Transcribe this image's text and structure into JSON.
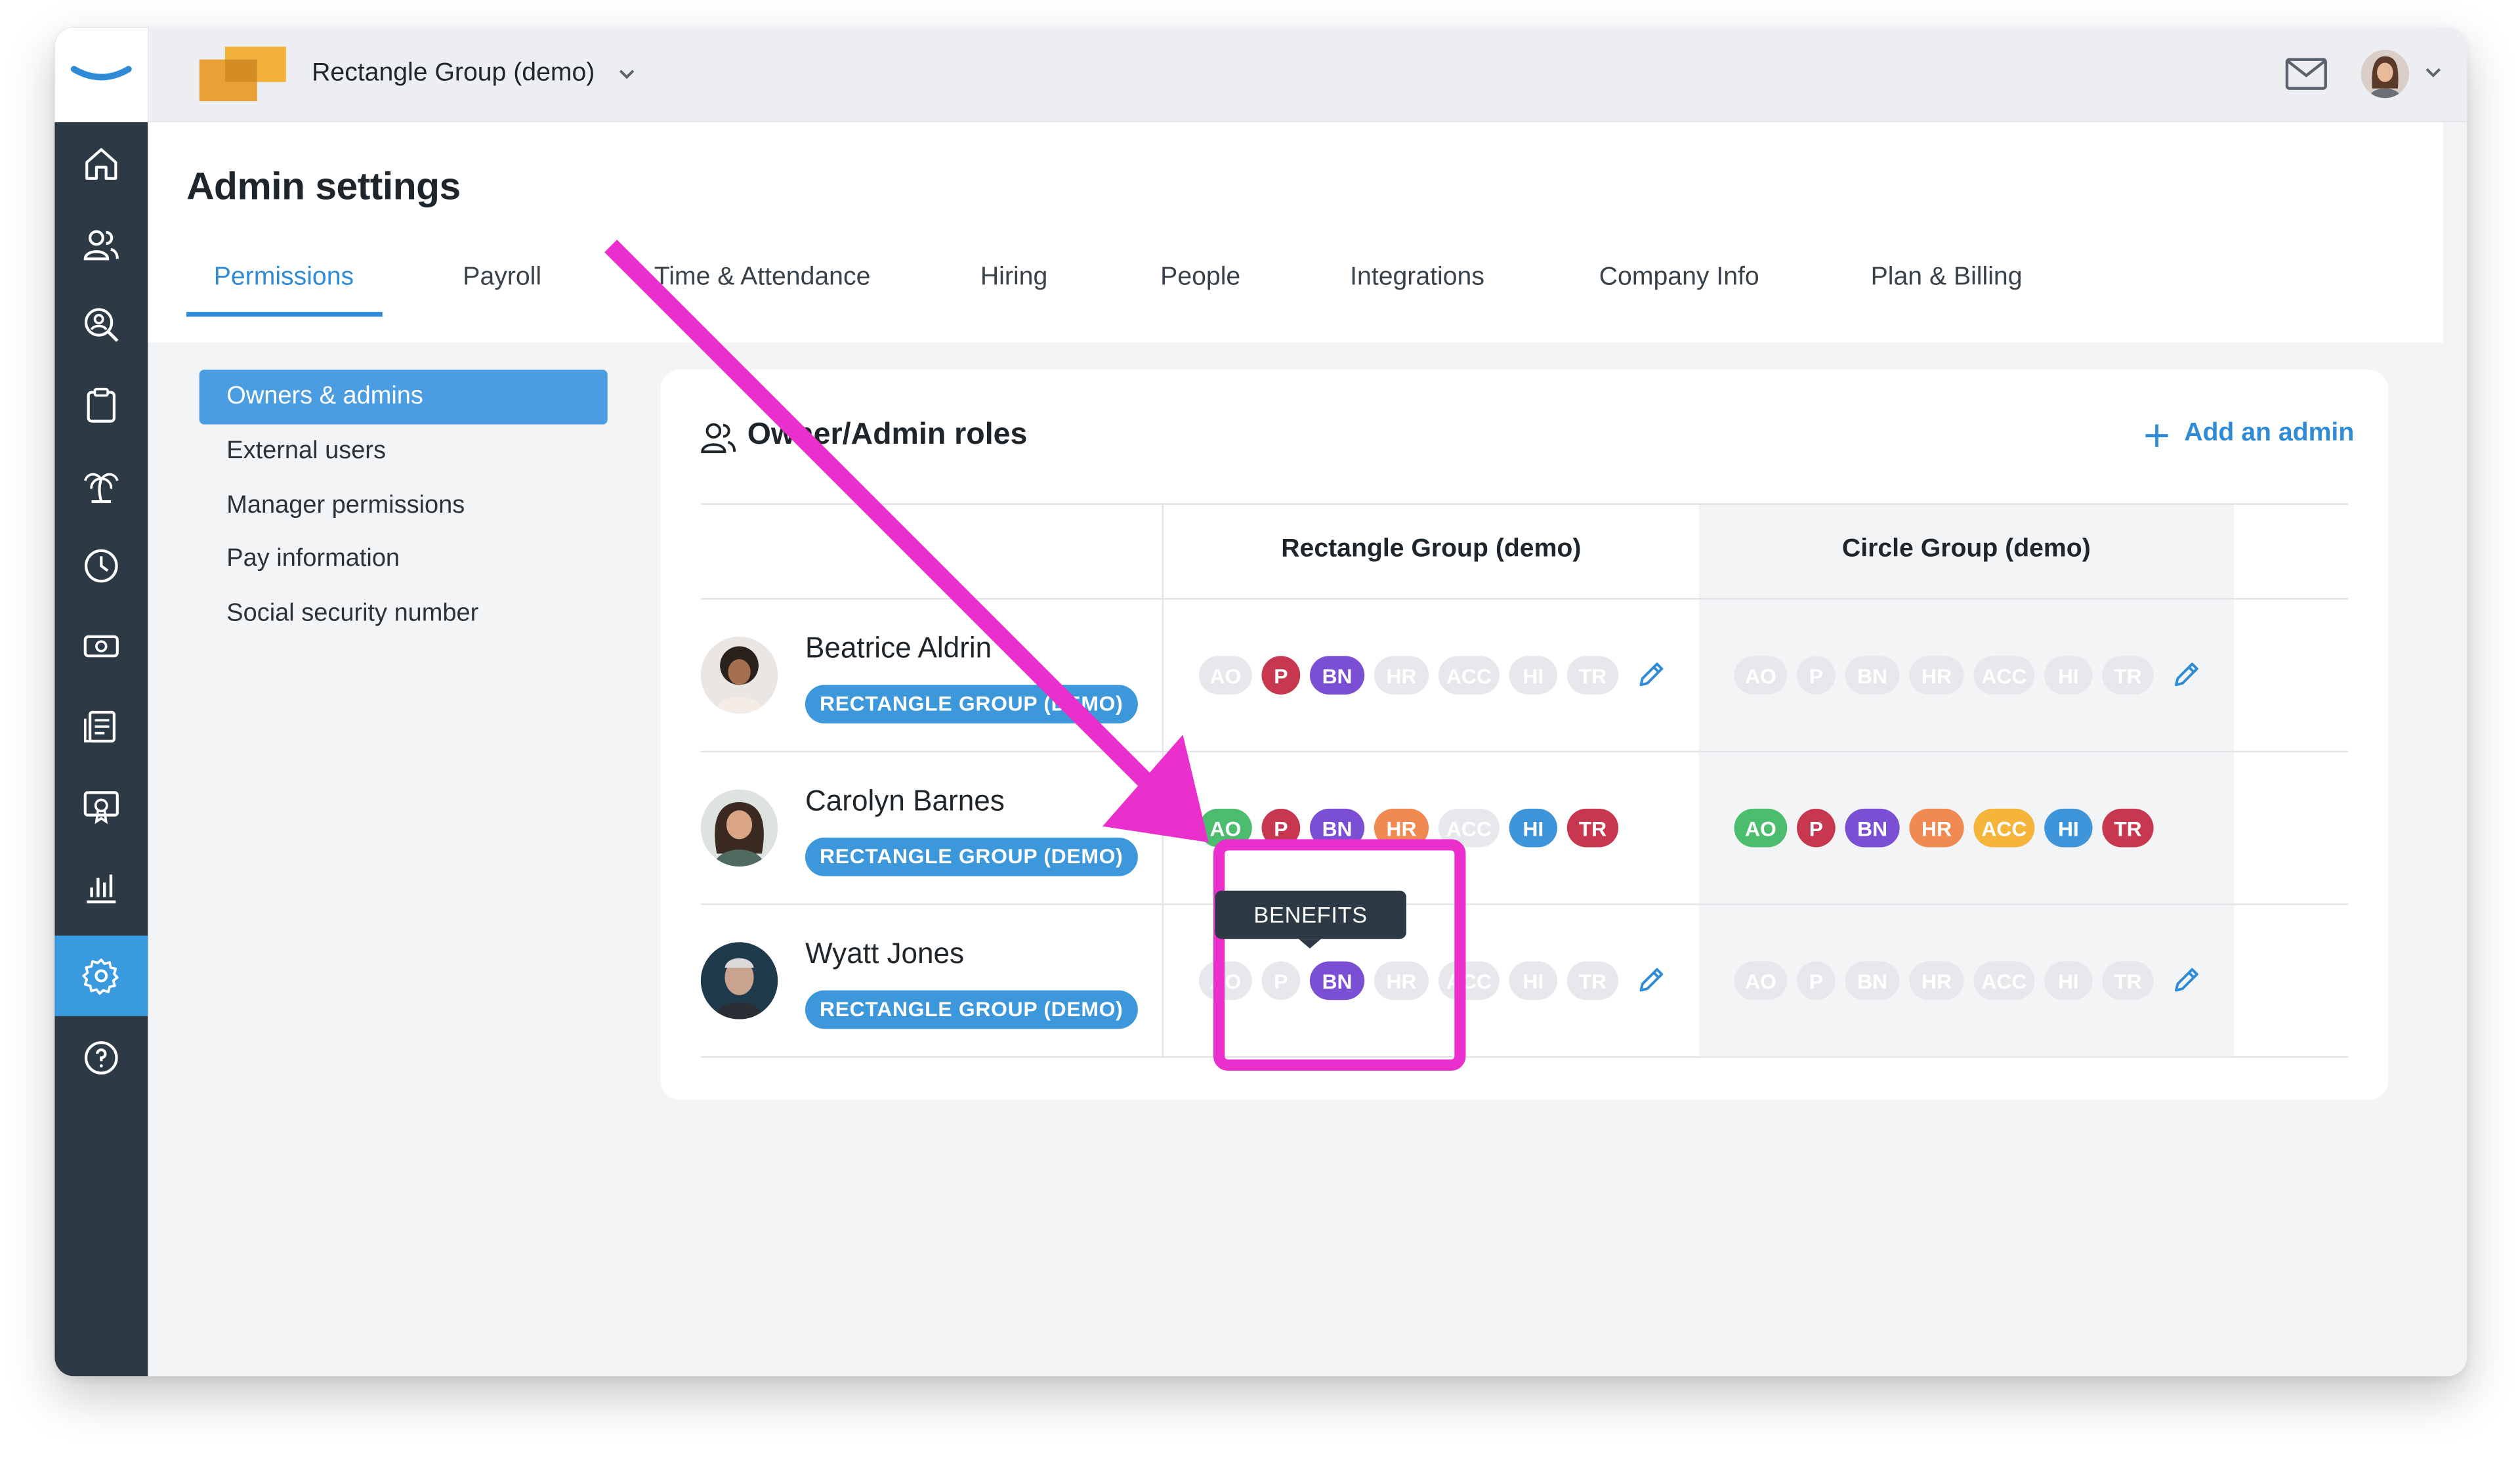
{
  "topbar": {
    "company_name": "Rectangle Group (demo)",
    "icons": [
      "brand-logo",
      "chevron-down-icon",
      "mail-icon",
      "avatar",
      "chevron-down-icon"
    ]
  },
  "rail": {
    "icons": [
      "home-icon",
      "people-icon",
      "search-person-icon",
      "clipboard-icon",
      "palm-tree-icon",
      "clock-icon",
      "money-icon",
      "document-icon",
      "certificate-icon",
      "bar-chart-icon",
      "gear-icon",
      "help-icon"
    ],
    "active": "gear-icon"
  },
  "page": {
    "title": "Admin settings",
    "tabs": [
      {
        "label": "Permissions",
        "active": true
      },
      {
        "label": "Payroll"
      },
      {
        "label": "Time & Attendance"
      },
      {
        "label": "Hiring"
      },
      {
        "label": "People"
      },
      {
        "label": "Integrations"
      },
      {
        "label": "Company Info"
      },
      {
        "label": "Plan & Billing"
      }
    ]
  },
  "sidenav": {
    "items": [
      {
        "label": "Owners & admins",
        "active": true
      },
      {
        "label": "External users"
      },
      {
        "label": "Manager permissions"
      },
      {
        "label": "Pay information"
      },
      {
        "label": "Social security number"
      }
    ]
  },
  "card": {
    "title": "Owner/Admin roles",
    "add_admin": "Add an admin",
    "columns": [
      "Rectangle Group (demo)",
      "Circle Group (demo)"
    ],
    "people": [
      {
        "name": "Beatrice Aldrin",
        "group": "RECTANGLE GROUP (DEMO)",
        "roles": [
          {
            "chips": [
              {
                "t": "AO",
                "on": false
              },
              {
                "t": "P",
                "on": true
              },
              {
                "t": "BN",
                "on": true
              },
              {
                "t": "HR",
                "on": false
              },
              {
                "t": "ACC",
                "on": false
              },
              {
                "t": "HI",
                "on": false
              },
              {
                "t": "TR",
                "on": false
              }
            ],
            "editable": true
          },
          {
            "chips": [
              {
                "t": "AO",
                "on": false
              },
              {
                "t": "P",
                "on": false
              },
              {
                "t": "BN",
                "on": false
              },
              {
                "t": "HR",
                "on": false
              },
              {
                "t": "ACC",
                "on": false
              },
              {
                "t": "HI",
                "on": false
              },
              {
                "t": "TR",
                "on": false
              }
            ],
            "editable": true
          }
        ]
      },
      {
        "name": "Carolyn Barnes",
        "group": "RECTANGLE GROUP (DEMO)",
        "roles": [
          {
            "chips": [
              {
                "t": "AO",
                "on": true
              },
              {
                "t": "P",
                "on": true
              },
              {
                "t": "BN",
                "on": true
              },
              {
                "t": "HR",
                "on": true
              },
              {
                "t": "ACC",
                "on": false
              },
              {
                "t": "HI",
                "on": true
              },
              {
                "t": "TR",
                "on": true
              }
            ],
            "editable": false
          },
          {
            "chips": [
              {
                "t": "AO",
                "on": true
              },
              {
                "t": "P",
                "on": true
              },
              {
                "t": "BN",
                "on": true
              },
              {
                "t": "HR",
                "on": true
              },
              {
                "t": "ACC",
                "on": true
              },
              {
                "t": "HI",
                "on": true
              },
              {
                "t": "TR",
                "on": true
              }
            ],
            "editable": false
          }
        ]
      },
      {
        "name": "Wyatt Jones",
        "group": "RECTANGLE GROUP (DEMO)",
        "roles": [
          {
            "chips": [
              {
                "t": "AO",
                "on": false
              },
              {
                "t": "P",
                "on": false
              },
              {
                "t": "BN",
                "on": true
              },
              {
                "t": "HR",
                "on": false
              },
              {
                "t": "ACC",
                "on": false
              },
              {
                "t": "HI",
                "on": false
              },
              {
                "t": "TR",
                "on": false
              }
            ],
            "editable": true
          },
          {
            "chips": [
              {
                "t": "AO",
                "on": false
              },
              {
                "t": "P",
                "on": false
              },
              {
                "t": "BN",
                "on": false
              },
              {
                "t": "HR",
                "on": false
              },
              {
                "t": "ACC",
                "on": false
              },
              {
                "t": "HI",
                "on": false
              },
              {
                "t": "TR",
                "on": false
              }
            ],
            "editable": true
          }
        ]
      }
    ],
    "role_colors": {
      "AO": "#4cbc6e",
      "P": "#c7374f",
      "BN": "#7b4fd4",
      "HR": "#f18a52",
      "ACC": "#f4b53a",
      "HI": "#3f95d9",
      "TR": "#c7374f"
    }
  },
  "tooltip": {
    "text": "BENEFITS"
  },
  "annotation": {
    "arrow_color": "#ea2fcc"
  }
}
